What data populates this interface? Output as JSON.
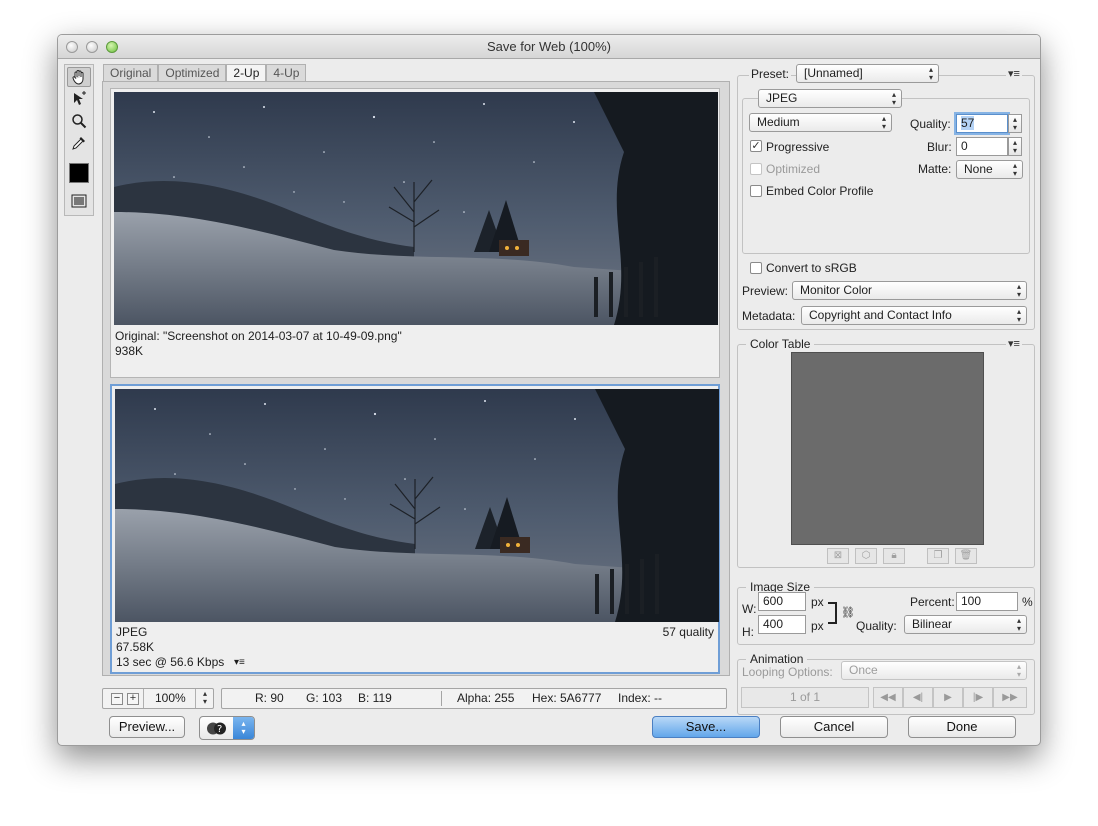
{
  "window": {
    "title": "Save for Web (100%)"
  },
  "tools": {
    "items": [
      "hand-icon",
      "slice-select-icon",
      "zoom-icon",
      "eyedropper-icon",
      "color-swatch",
      "toggle-slices-icon"
    ],
    "swatch_color": "#000000"
  },
  "tabs": [
    "Original",
    "Optimized",
    "2-Up",
    "4-Up"
  ],
  "active_tab": "2-Up",
  "original_pane": {
    "caption": "Original: \"Screenshot on 2014-03-07 at 10-49-09.png\"",
    "size": "938K"
  },
  "optimized_pane": {
    "format": "JPEG",
    "quality_note": "57 quality",
    "size": "67.58K",
    "download_time": "13 sec @ 56.6 Kbps"
  },
  "statusbar": {
    "zoom": "100%",
    "r": "R: 90",
    "g": "G: 103",
    "b": "B: 119",
    "alpha": "Alpha: 255",
    "hex": "Hex: 5A6777",
    "index": "Index: --"
  },
  "bottom_buttons": {
    "preview": "Preview...",
    "save": "Save...",
    "cancel": "Cancel",
    "done": "Done"
  },
  "preset": {
    "label": "Preset:",
    "value": "[Unnamed]"
  },
  "settings": {
    "format": "JPEG",
    "compression": "Medium",
    "quality_label": "Quality:",
    "quality_value": "57",
    "progressive_label": "Progressive",
    "progressive_checked": true,
    "blur_label": "Blur:",
    "blur_value": "0",
    "optimized_label": "Optimized",
    "optimized_checked": false,
    "matte_label": "Matte:",
    "matte_value": "None",
    "embed_label": "Embed Color Profile",
    "embed_checked": false,
    "convert_label": "Convert to sRGB",
    "convert_checked": false,
    "preview_label": "Preview:",
    "preview_value": "Monitor Color",
    "metadata_label": "Metadata:",
    "metadata_value": "Copyright and Contact Info"
  },
  "color_table": {
    "title": "Color Table",
    "fill": "#6b6b6b"
  },
  "image_size": {
    "title": "Image Size",
    "w_label": "W:",
    "w_value": "600",
    "h_label": "H:",
    "h_value": "400",
    "unit": "px",
    "percent_label": "Percent:",
    "percent_value": "100",
    "percent_unit": "%",
    "quality_label": "Quality:",
    "quality_value": "Bilinear"
  },
  "animation": {
    "title": "Animation",
    "looping_label": "Looping Options:",
    "looping_value": "Once",
    "frame_counter": "1 of 1"
  },
  "colors": {
    "accent": "#6f9ed6",
    "save_button": "#62a6ea"
  }
}
